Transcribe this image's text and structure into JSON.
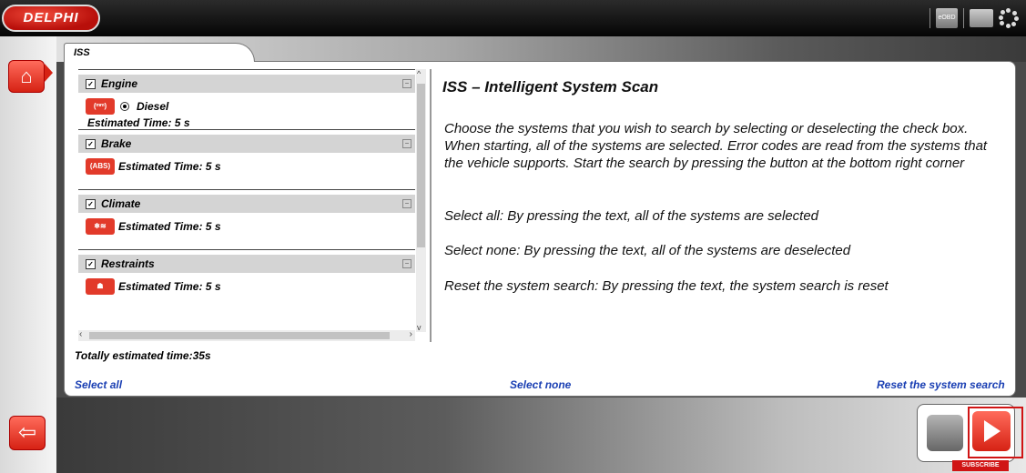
{
  "header": {
    "logo_text": "DELPHI",
    "eobd_label": "eOBD"
  },
  "tab": {
    "label": "ISS"
  },
  "systems": [
    {
      "name": "Engine",
      "icon": "engine-glow-icon",
      "icon_text": "(ᵐᵐ)",
      "fuel": "Diesel",
      "time": "Estimated Time: 5 s"
    },
    {
      "name": "Brake",
      "icon": "abs-icon",
      "icon_text": "(ABS)",
      "time": "Estimated Time: 5 s"
    },
    {
      "name": "Climate",
      "icon": "climate-icon",
      "icon_text": "❄≋",
      "time": "Estimated Time: 5 s"
    },
    {
      "name": "Restraints",
      "icon": "airbag-icon",
      "icon_text": "☗",
      "time": "Estimated Time: 5 s"
    }
  ],
  "total_time": "Totally estimated time:35s",
  "links": {
    "select_all": "Select all",
    "select_none": "Select none",
    "reset": "Reset the system search"
  },
  "help": {
    "title": "ISS – Intelligent System Scan",
    "p1": "Choose the systems that you wish to search by selecting or deselecting the check box. When starting, all of the systems are selected. Error codes are read from the systems that the vehicle supports. Start the search by pressing the button at the bottom right corner",
    "p2": "Select all: By pressing the text, all of the systems are selected",
    "p3": "Select none: By pressing the text, all of the systems are deselected",
    "p4": "Reset the system search: By pressing the text, the system search is reset"
  },
  "overlay": {
    "subscribe": "SUBSCRIBE"
  },
  "colors": {
    "accent": "#d62214",
    "link": "#1a3fb3"
  }
}
